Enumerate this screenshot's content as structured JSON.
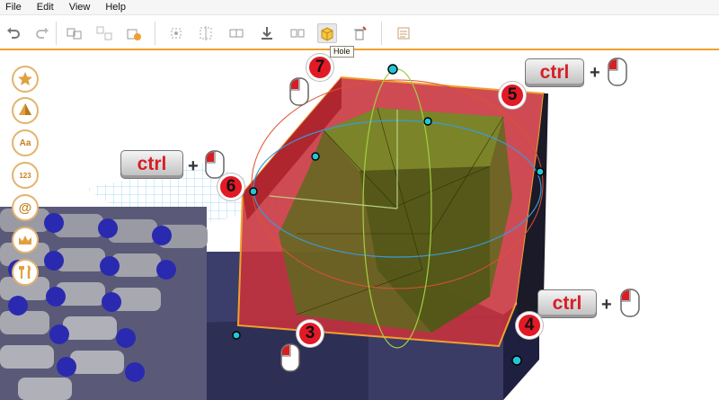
{
  "menu": {
    "items": [
      {
        "label": "File"
      },
      {
        "label": "Edit"
      },
      {
        "label": "View"
      },
      {
        "label": "Help"
      }
    ]
  },
  "toolbar": {
    "buttons": [
      {
        "icon": "undo-icon"
      },
      {
        "icon": "redo-icon"
      },
      {
        "icon": "group-icon"
      },
      {
        "icon": "ungroup-icon"
      },
      {
        "icon": "import-shape-icon"
      },
      {
        "icon": "align-icon"
      },
      {
        "icon": "flip-icon"
      },
      {
        "icon": "duplicate-icon"
      },
      {
        "icon": "download-icon"
      },
      {
        "icon": "mirror-icon"
      },
      {
        "icon": "hole-icon",
        "active": true
      },
      {
        "icon": "delete-icon"
      },
      {
        "icon": "notes-icon"
      }
    ],
    "tooltip": "Hole"
  },
  "sidebar": {
    "buttons": [
      {
        "icon": "star-icon"
      },
      {
        "icon": "shapes-icon"
      },
      {
        "icon": "text-icon",
        "label": "Aa"
      },
      {
        "icon": "numbers-icon",
        "label": "123"
      },
      {
        "icon": "at-sign-icon",
        "label": "@"
      },
      {
        "icon": "crown-icon"
      },
      {
        "icon": "tools-icon"
      }
    ]
  },
  "annotations": {
    "steps": [
      "3",
      "4",
      "5",
      "6",
      "7"
    ],
    "key_label": "ctrl",
    "plus": "+"
  },
  "colors": {
    "accent": "#f0a030",
    "hole_red": "#c8323c",
    "badge_red": "#e21a26",
    "gizmo_cyan": "#22c6d6"
  }
}
